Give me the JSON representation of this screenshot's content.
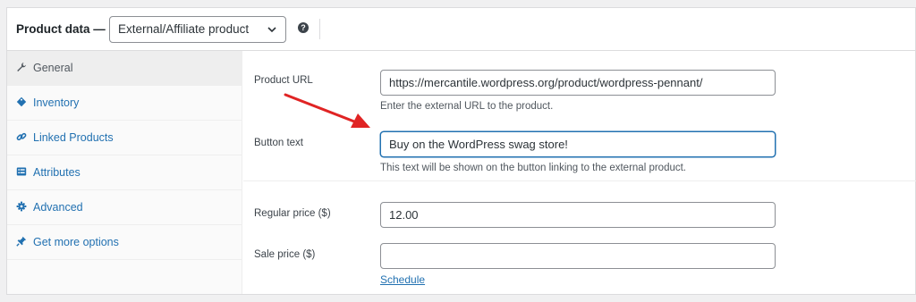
{
  "header": {
    "title": "Product data —",
    "product_type": "External/Affiliate product",
    "help": "?"
  },
  "tabs": [
    {
      "label": "General",
      "icon": "wrench-icon",
      "active": true
    },
    {
      "label": "Inventory",
      "icon": "tag-icon",
      "active": false
    },
    {
      "label": "Linked Products",
      "icon": "link-icon",
      "active": false
    },
    {
      "label": "Attributes",
      "icon": "list-icon",
      "active": false
    },
    {
      "label": "Advanced",
      "icon": "gear-icon",
      "active": false
    },
    {
      "label": "Get more options",
      "icon": "plugin-icon",
      "active": false
    }
  ],
  "fields": {
    "product_url": {
      "label": "Product URL",
      "value": "https://mercantile.wordpress.org/product/wordpress-pennant/",
      "description": "Enter the external URL to the product."
    },
    "button_text": {
      "label": "Button text",
      "value": "Buy on the WordPress swag store!",
      "description": "This text will be shown on the button linking to the external product."
    },
    "regular_price": {
      "label": "Regular price ($)",
      "value": "12.00"
    },
    "sale_price": {
      "label": "Sale price ($)",
      "value": "",
      "schedule_link": "Schedule"
    }
  },
  "colors": {
    "link": "#2271b1",
    "annotation_arrow": "#e02424",
    "active_tab_bg": "#eeeeee"
  }
}
